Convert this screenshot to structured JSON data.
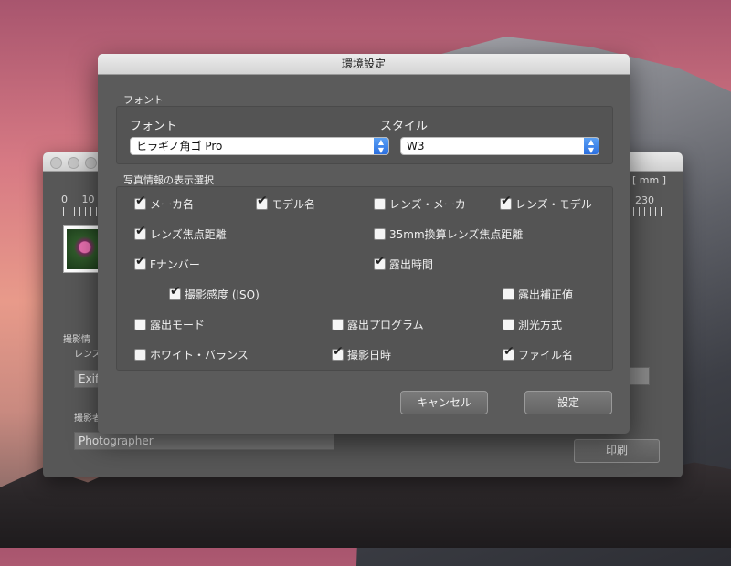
{
  "dialog": {
    "title": "環境設定",
    "font_section": {
      "label": "フォント",
      "font_col_label": "フォント",
      "style_col_label": "スタイル",
      "font_value": "ヒラギノ角ゴ Pro",
      "style_value": "W3"
    },
    "info_section": {
      "label": "写真情報の表示選択",
      "items": [
        {
          "label": "メーカ名",
          "checked": true
        },
        {
          "label": "モデル名",
          "checked": true
        },
        {
          "label": "レンズ・メーカ",
          "checked": false
        },
        {
          "label": "レンズ・モデル",
          "checked": true
        },
        {
          "label": "レンズ焦点距離",
          "checked": true
        },
        {
          "label": "35mm換算レンズ焦点距離",
          "checked": false
        },
        {
          "label": "Fナンバー",
          "checked": true
        },
        {
          "label": "露出時間",
          "checked": true
        },
        {
          "label": "撮影感度 (ISO)",
          "checked": true
        },
        {
          "label": "露出補正値",
          "checked": false
        },
        {
          "label": "露出モード",
          "checked": false
        },
        {
          "label": "露出プログラム",
          "checked": false
        },
        {
          "label": "測光方式",
          "checked": false
        },
        {
          "label": "ホワイト・バランス",
          "checked": false
        },
        {
          "label": "撮影日時",
          "checked": true
        },
        {
          "label": "ファイル名",
          "checked": true
        }
      ]
    },
    "buttons": {
      "cancel": "キャンセル",
      "ok": "設定"
    }
  },
  "background_window": {
    "ruler_left": [
      "0",
      "10"
    ],
    "ruler_right_label": "[ mm ]",
    "ruler_right_value": "230",
    "label_shooting_info": "撮影情",
    "label_lens": "レンズ",
    "field_exif": "Exif",
    "label_photographer": "撮影者",
    "field_photographer": "Photographer",
    "print_button": "印刷"
  },
  "check_glyph": "✔"
}
